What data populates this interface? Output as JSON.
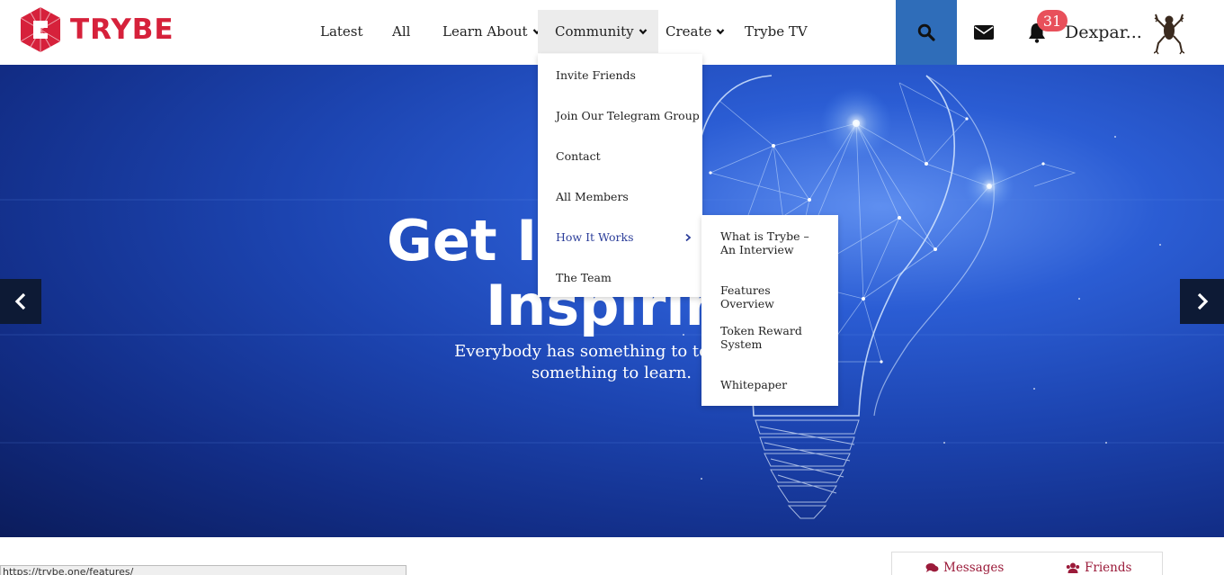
{
  "brand": {
    "name": "TRYBE",
    "color": "#d6213b",
    "logo_icon": "trybe-logo-icon"
  },
  "nav": {
    "items": [
      {
        "label": "Latest",
        "has_menu": false
      },
      {
        "label": "All",
        "has_menu": false
      },
      {
        "label": "Learn About",
        "has_menu": true
      },
      {
        "label": "Community",
        "has_menu": true,
        "active": true
      },
      {
        "label": "Create",
        "has_menu": true
      },
      {
        "label": "Trybe TV",
        "has_menu": false
      }
    ]
  },
  "header_actions": {
    "search_icon": "search-icon",
    "search_bg": "#2f6db9",
    "mail_icon": "envelope-icon",
    "bell_icon": "bell-icon",
    "notification_count": "31",
    "badge_color": "#e8505b",
    "username": "Dexpar...",
    "avatar": "frog-avatar"
  },
  "community_menu": {
    "items": [
      {
        "label": "Invite Friends"
      },
      {
        "label": "Join Our Telegram Group"
      },
      {
        "label": "Contact"
      },
      {
        "label": "All Members"
      },
      {
        "label": "How It Works",
        "has_submenu": true,
        "highlighted": true
      },
      {
        "label": "The Team"
      }
    ],
    "highlight_color": "#2c3e9a"
  },
  "how_it_works_menu": {
    "items": [
      {
        "label": "What is Trybe – An Interview"
      },
      {
        "label": "Features Overview"
      },
      {
        "label": "Token Reward System"
      },
      {
        "label": "Whitepaper"
      }
    ]
  },
  "hero": {
    "title_line1": "Get In",
    "title_line2": "Inspiring",
    "subtitle": "Everybody has something to teach. Ev something to learn.",
    "prev_icon": "chevron-left-icon",
    "next_icon": "chevron-right-icon"
  },
  "status_bar": {
    "url": "https://trybe.one/features/"
  },
  "widget": {
    "tabs": [
      {
        "label": "Messages",
        "icon": "comments-icon"
      },
      {
        "label": "Friends",
        "icon": "users-icon"
      }
    ],
    "accent": "#9b1b3a"
  }
}
